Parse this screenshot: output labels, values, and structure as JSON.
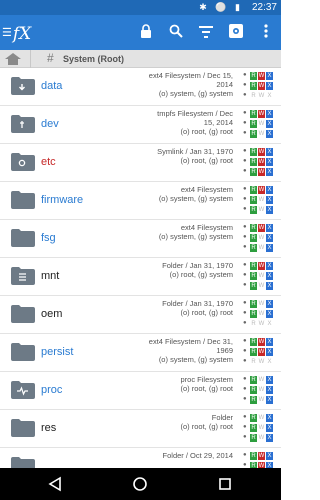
{
  "status": {
    "icons": "✱ ⚪ ▮",
    "time": "22:37"
  },
  "toolbar": {
    "logo": "fX",
    "icons": [
      "lock-icon",
      "search-icon",
      "filter-icon",
      "settings-icon",
      "more-vert-icon"
    ]
  },
  "breadcrumb": {
    "path": "System (Root)"
  },
  "rows": [
    {
      "name": "data",
      "icon": "download-folder-icon",
      "accent": "#2a7bd1",
      "info1": "ext4 Filesystem / Dec 15,",
      "info2": "2014",
      "info3": "(o) system, (g) system",
      "perm": [
        [
          "R",
          "W",
          "X"
        ],
        [
          "R",
          "W",
          "X"
        ],
        [
          "R",
          "W",
          "X"
        ]
      ],
      "on": [
        [
          1,
          1,
          1
        ],
        [
          1,
          1,
          1
        ],
        [
          0,
          0,
          0
        ]
      ]
    },
    {
      "name": "dev",
      "icon": "usb-folder-icon",
      "accent": "#2a7bd1",
      "info1": "tmpfs Filesystem / Dec",
      "info2": "15, 2014",
      "info3": "(o) root, (g) root",
      "perm": [
        [
          "R",
          "W",
          "X"
        ],
        [
          "R",
          "W",
          "X"
        ],
        [
          "R",
          "W",
          "X"
        ]
      ],
      "on": [
        [
          1,
          1,
          1
        ],
        [
          1,
          0,
          1
        ],
        [
          1,
          0,
          1
        ]
      ]
    },
    {
      "name": "etc",
      "icon": "gear-folder-icon",
      "accent": "#c62828",
      "info1": "Symlink / Jan 31, 1970",
      "info2": "",
      "info3": "(o) root, (g) root",
      "perm": [
        [
          "R",
          "W",
          "X"
        ],
        [
          "R",
          "W",
          "X"
        ],
        [
          "R",
          "W",
          "X"
        ]
      ],
      "on": [
        [
          1,
          1,
          1
        ],
        [
          1,
          1,
          1
        ],
        [
          1,
          1,
          1
        ]
      ]
    },
    {
      "name": "firmware",
      "icon": "folder-icon",
      "accent": "#2a7bd1",
      "info1": "ext4 Filesystem",
      "info2": "",
      "info3": "(o) system, (g) system",
      "perm": [
        [
          "R",
          "W",
          "X"
        ],
        [
          "R",
          "W",
          "X"
        ],
        [
          "R",
          "W",
          "X"
        ]
      ],
      "on": [
        [
          1,
          1,
          1
        ],
        [
          1,
          0,
          1
        ],
        [
          1,
          0,
          1
        ]
      ]
    },
    {
      "name": "fsg",
      "icon": "folder-icon",
      "accent": "#2a7bd1",
      "info1": "ext4 Filesystem",
      "info2": "",
      "info3": "(o) system, (g) system",
      "perm": [
        [
          "R",
          "W",
          "X"
        ],
        [
          "R",
          "W",
          "X"
        ],
        [
          "R",
          "W",
          "X"
        ]
      ],
      "on": [
        [
          1,
          1,
          1
        ],
        [
          1,
          0,
          1
        ],
        [
          1,
          0,
          1
        ]
      ]
    },
    {
      "name": "mnt",
      "icon": "list-folder-icon",
      "accent": "#222222",
      "info1": "Folder / Jan 31, 1970",
      "info2": "",
      "info3": "(o) root, (g) system",
      "perm": [
        [
          "R",
          "W",
          "X"
        ],
        [
          "R",
          "W",
          "X"
        ],
        [
          "R",
          "W",
          "X"
        ]
      ],
      "on": [
        [
          1,
          1,
          1
        ],
        [
          1,
          0,
          1
        ],
        [
          1,
          0,
          1
        ]
      ]
    },
    {
      "name": "oem",
      "icon": "folder-icon",
      "accent": "#222222",
      "info1": "Folder / Jan 31, 1970",
      "info2": "",
      "info3": "(o) root, (g) root",
      "perm": [
        [
          "R",
          "W",
          "X"
        ],
        [
          "R",
          "W",
          "X"
        ],
        [
          "R",
          "W",
          "X"
        ]
      ],
      "on": [
        [
          1,
          0,
          1
        ],
        [
          1,
          0,
          1
        ],
        [
          0,
          0,
          0
        ]
      ]
    },
    {
      "name": "persist",
      "icon": "folder-icon",
      "accent": "#2a7bd1",
      "info1": "ext4 Filesystem / Dec 31,",
      "info2": "1969",
      "info3": "(o) system, (g) system",
      "perm": [
        [
          "R",
          "W",
          "X"
        ],
        [
          "R",
          "W",
          "X"
        ],
        [
          "R",
          "W",
          "X"
        ]
      ],
      "on": [
        [
          1,
          1,
          1
        ],
        [
          1,
          1,
          1
        ],
        [
          0,
          0,
          0
        ]
      ]
    },
    {
      "name": "proc",
      "icon": "pulse-folder-icon",
      "accent": "#2a7bd1",
      "info1": "proc Filesystem",
      "info2": "",
      "info3": "(o) root, (g) root",
      "perm": [
        [
          "R",
          "W",
          "X"
        ],
        [
          "R",
          "W",
          "X"
        ],
        [
          "R",
          "W",
          "X"
        ]
      ],
      "on": [
        [
          1,
          0,
          1
        ],
        [
          1,
          0,
          1
        ],
        [
          1,
          0,
          1
        ]
      ]
    },
    {
      "name": "res",
      "icon": "folder-icon",
      "accent": "#222222",
      "info1": "Folder",
      "info2": "",
      "info3": "(o) root, (g) root",
      "perm": [
        [
          "R",
          "W",
          "X"
        ],
        [
          "R",
          "W",
          "X"
        ],
        [
          "R",
          "W",
          "X"
        ]
      ],
      "on": [
        [
          1,
          0,
          1
        ],
        [
          1,
          0,
          1
        ],
        [
          1,
          0,
          1
        ]
      ]
    },
    {
      "name": "",
      "icon": "folder-icon",
      "accent": "#222222",
      "info1": "Folder / Oct 29, 2014",
      "info2": "",
      "info3": "",
      "perm": [
        [
          "R",
          "W",
          "X"
        ],
        [
          "R",
          "W",
          "X"
        ],
        [
          "R",
          "W",
          "X"
        ]
      ],
      "on": [
        [
          1,
          1,
          1
        ],
        [
          1,
          1,
          1
        ],
        [
          1,
          1,
          1
        ]
      ]
    }
  ]
}
